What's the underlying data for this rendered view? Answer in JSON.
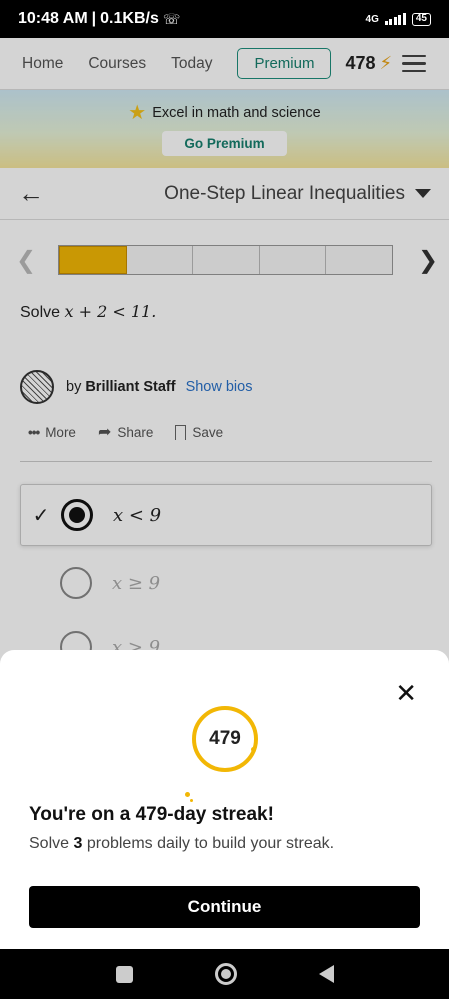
{
  "status_bar": {
    "time": "10:48 AM",
    "speed": "0.1KB/s",
    "network": "4G",
    "battery": "45"
  },
  "top_nav": {
    "links": [
      "Home",
      "Courses",
      "Today"
    ],
    "premium_label": "Premium",
    "streak_count": "478"
  },
  "banner": {
    "text": "Excel in math and science",
    "button": "Go Premium"
  },
  "lesson": {
    "title": "One-Step Linear Inequalities",
    "progress": {
      "total_segments": 5,
      "completed": 1
    }
  },
  "problem": {
    "prefix": "Solve",
    "math": "x + 2 < 11."
  },
  "author": {
    "by": "by",
    "name": "Brilliant Staff",
    "show_bios": "Show bios"
  },
  "actions": {
    "more": "More",
    "share": "Share",
    "save": "Save"
  },
  "choices": [
    {
      "math": "x < 9",
      "selected": true
    },
    {
      "math": "x ≥ 9",
      "selected": false
    },
    {
      "math": "x > 9",
      "selected": false
    }
  ],
  "streak_modal": {
    "badge": "479",
    "title": "You're on a 479-day streak!",
    "subtitle_pre": "Solve",
    "subtitle_count": "3",
    "subtitle_post": "problems daily to build your streak.",
    "continue_label": "Continue"
  },
  "colors": {
    "accent_teal": "#17806e",
    "gold": "#f2b705",
    "link_blue": "#2a72c9"
  }
}
